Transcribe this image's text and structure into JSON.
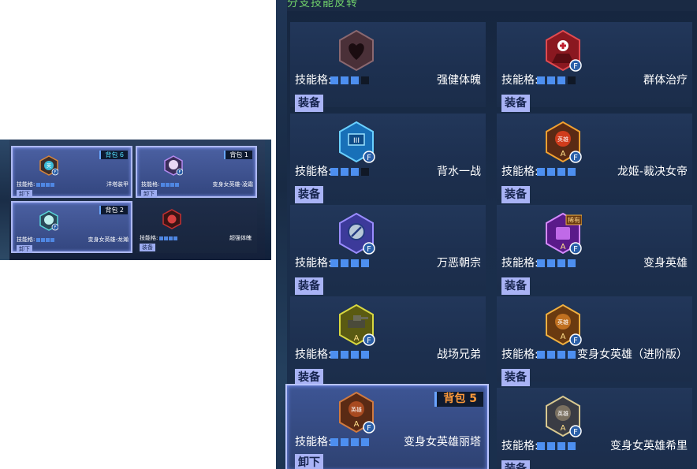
{
  "banner_text": "分支技能反转",
  "mini_panel": {
    "cards": [
      {
        "tag": "背包 6",
        "tag_color": "cyan",
        "name": "洋塔装甲",
        "label": "技能格:",
        "button": "卸下",
        "equipped": true
      },
      {
        "tag": "背包 1",
        "tag_color": "white",
        "name": "变身女英雄-凌霜",
        "label": "技能格:",
        "button": "卸下",
        "equipped": true
      },
      {
        "tag": "背包 2",
        "tag_color": "white",
        "name": "变身女英雄-龙瀚",
        "label": "技能格:",
        "button": "卸下",
        "equipped": true
      },
      {
        "tag": "",
        "tag_color": "white",
        "name": "超强体魄",
        "label": "技能格:",
        "button": "装备",
        "equipped": false
      }
    ]
  },
  "main_panel": {
    "cards": [
      {
        "name": "强健体魄",
        "label": "技能格:",
        "button": "装备",
        "slots": 3,
        "icon": "dark-heart-icon",
        "badge": "F"
      },
      {
        "name": "群体治疗",
        "label": "技能格:",
        "button": "装备",
        "slots": 3,
        "icon": "red-heal-icon",
        "badge": "F"
      },
      {
        "name": "背水一战",
        "label": "技能格:",
        "button": "装备",
        "slots": 3,
        "icon": "blue-shield-icon",
        "badge": "F"
      },
      {
        "name": "龙姬-裁决女帝",
        "label": "技能格:",
        "button": "装备",
        "slots": 4,
        "icon": "hero-portrait-icon",
        "badge": "F"
      },
      {
        "name": "万恶朝宗",
        "label": "技能格:",
        "button": "装备",
        "slots": 4,
        "icon": "compass-icon",
        "badge": "F"
      },
      {
        "name": "变身英雄",
        "label": "技能格:",
        "button": "装备",
        "slots": 4,
        "icon": "purple-hero-icon",
        "badge": "F",
        "ribbon": "稀有"
      },
      {
        "name": "战场兄弟",
        "label": "技能格:",
        "button": "装备",
        "slots": 4,
        "icon": "tank-icon",
        "badge": "F"
      },
      {
        "name": "变身女英雄（进阶版）",
        "label": "技能格:",
        "button": "装备",
        "slots": 4,
        "icon": "hero-gold-icon",
        "badge": "F"
      },
      {
        "name": "变身女英雄丽塔",
        "label": "技能格:",
        "button": "卸下",
        "slots": 4,
        "icon": "hero-bronze-icon",
        "badge": "F",
        "tag": "背包 5",
        "equipped": true
      },
      {
        "name": "变身女英雄希里",
        "label": "技能格:",
        "button": "装备",
        "slots": 4,
        "icon": "hero-silver-icon",
        "badge": "F"
      }
    ]
  },
  "colors": {
    "slot_on": "#4d8ff0",
    "slot_off": "#101826",
    "button_bg": "#a9b3f5",
    "tag_text": "#ff9a3a",
    "equipped_border": "#b9c4ff"
  }
}
